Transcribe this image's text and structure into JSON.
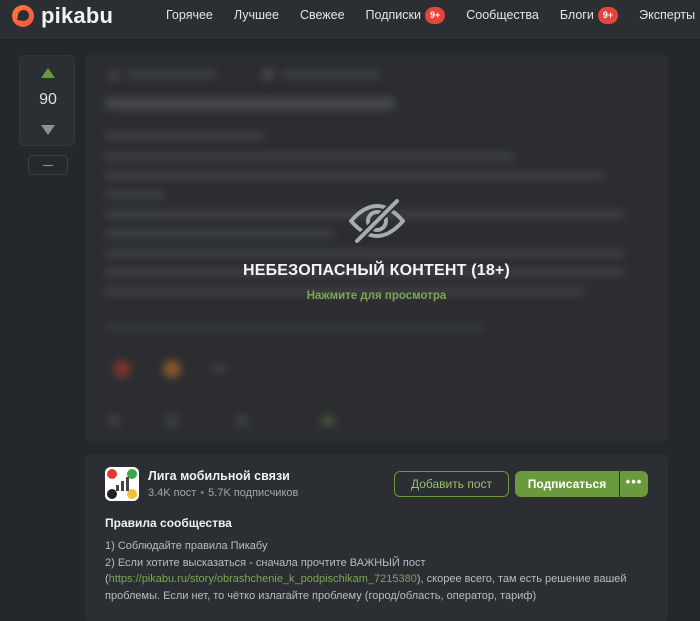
{
  "header": {
    "logo_text": "pikabu",
    "nav": [
      {
        "label": "Горячее"
      },
      {
        "label": "Лучшее"
      },
      {
        "label": "Свежее"
      },
      {
        "label": "Подписки",
        "badge": "9+"
      },
      {
        "label": "Сообщества"
      },
      {
        "label": "Блоги",
        "badge": "9+"
      },
      {
        "label": "Эксперты"
      }
    ]
  },
  "post": {
    "rating": "90",
    "nsfw_title": "НЕБЕЗОПАСНЫЙ КОНТЕНТ (18+)",
    "nsfw_hint": "Нажмите для просмотра"
  },
  "community": {
    "name": "Лига мобильной связи",
    "posts": "3.4K пост",
    "separator": "•",
    "subscribers": "5.7K подписчиков",
    "add_post_label": "Добавить пост",
    "subscribe_label": "Подписаться",
    "more_label": "•••",
    "rules_title": "Правила сообщества",
    "rules": {
      "line1": "1) Соблюдайте правила Пикабу",
      "line2": "2) Если хотите высказаться - сначала прочтите ВАЖНЫЙ пост",
      "link_open": "(",
      "link": "https://pikabu.ru/story/obrashchenie_k_podpischikam_7215380",
      "line3": "), скорее всего, там есть решение вашей проблемы. Если нет, то чётко излагайте проблему (город/область, оператор, тариф)"
    }
  },
  "colors": {
    "accent_green": "#6b9a3c",
    "badge_red": "#e4443b",
    "logo_orange": "#f2543b"
  },
  "icons": [
    "pikabu-logo-icon",
    "upvote-icon",
    "downvote-icon",
    "hidden-eye-icon",
    "more-icon"
  ]
}
